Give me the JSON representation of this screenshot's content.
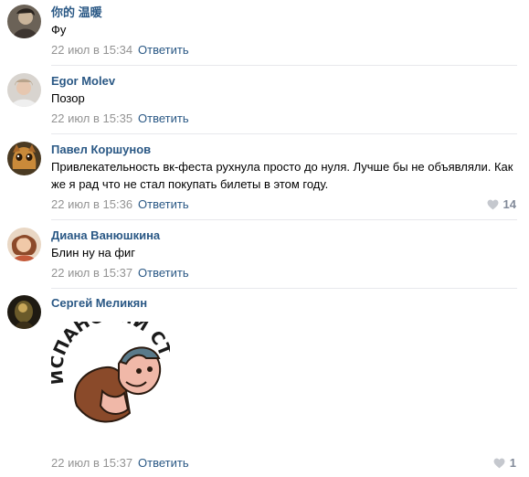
{
  "comments": [
    {
      "author": "你的 温暖",
      "text": "Фу",
      "date": "22 июл в 15:34",
      "reply": "Ответить",
      "likes": ""
    },
    {
      "author": "Egor Molev",
      "text": "Позор",
      "date": "22 июл в 15:35",
      "reply": "Ответить",
      "likes": ""
    },
    {
      "author": "Павел Коршунов",
      "text": "Привлекательность вк-феста рухнула просто до нуля. Лучше бы не объявляли. Как же я рад что не стал покупать билеты в этом году.",
      "date": "22 июл в 15:36",
      "reply": "Ответить",
      "likes": "14"
    },
    {
      "author": "Диана Ванюшкина",
      "text": "Блин ну на фиг",
      "date": "22 июл в 15:37",
      "reply": "Ответить",
      "likes": ""
    },
    {
      "author": "Сергей Меликян",
      "text": "",
      "date": "22 июл в 15:37",
      "reply": "Ответить",
      "likes": "1",
      "sticker_text": "ИСПАНСКИЙ СТЫД"
    }
  ],
  "icons": {
    "like": "heart-icon"
  },
  "colors": {
    "link": "#2a5885",
    "date": "#939393",
    "separator": "#e7e8ec",
    "like": "#828a99"
  }
}
